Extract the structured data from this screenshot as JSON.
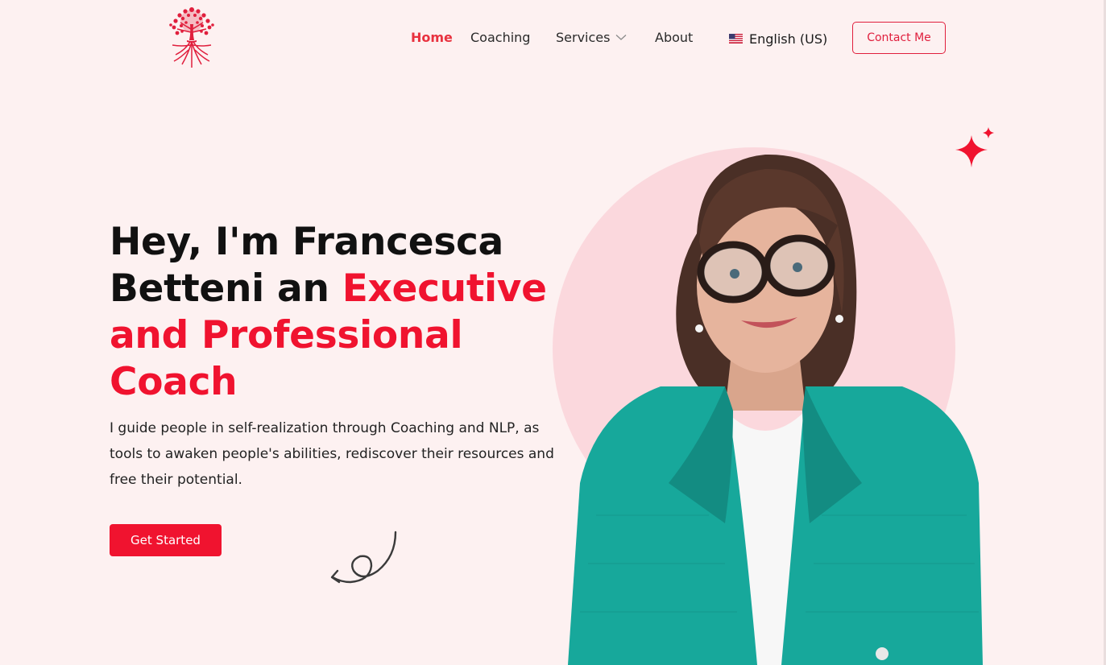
{
  "header": {
    "logo_icon": "tree-of-life-logo",
    "nav": {
      "home": "Home",
      "coaching": "Coaching",
      "services": "Services",
      "about": "About"
    },
    "language": "English (US)",
    "contact_label": "Contact Me"
  },
  "hero": {
    "headline_black": "Hey, I'm Francesca Betteni an",
    "headline_red": "Executive and Professional Coach",
    "description": "I guide people in self-realization through Coaching and NLP, as tools to awaken people's abilities, rediscover their resources and free their potential.",
    "cta_label": "Get Started"
  },
  "colors": {
    "accent": "#f0132f",
    "background": "#fdf1f1",
    "circle": "#fbd8dd",
    "jacket": "#17a89b"
  }
}
